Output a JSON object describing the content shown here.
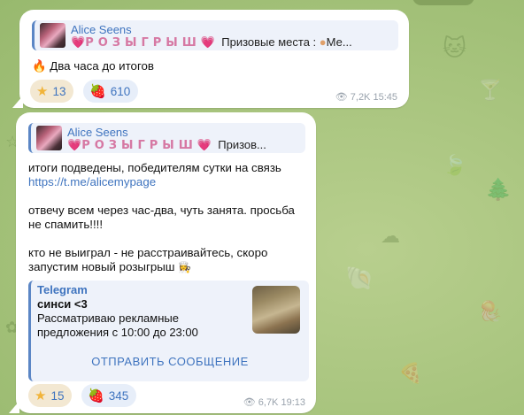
{
  "messages": [
    {
      "reply": {
        "author": "Alice Seens",
        "heart_left": "💗",
        "giveaway_word": "РОЗЫГРЫШ",
        "heart_right": "💗",
        "preview_text": "Призовые места :",
        "preview_tail": "Ме..."
      },
      "text_icon": "fire-icon",
      "text": "Два часа до итогов",
      "reactions": [
        {
          "icon": "star-icon",
          "count": "13"
        },
        {
          "icon": "strawberry-icon",
          "count": "610"
        }
      ],
      "views": "7,2K",
      "time": "15:45"
    },
    {
      "reply": {
        "author": "Alice Seens",
        "heart_left": "💗",
        "giveaway_word": "РОЗЫГРЫШ",
        "heart_right": "💗",
        "preview_text": "Призов..."
      },
      "text_line1": "итоги подведены, победителям сутки на связь",
      "link": "https://t.me/alicemypage",
      "text_para2": "отвечу всем через час-два, чуть занята. просьба\nне спамить!!!!",
      "text_para3": "кто не выиграл - не расстраивайтесь, скоро\nзапустим новый розыгрыш",
      "link_preview": {
        "site": "Telegram",
        "title": "синси <3",
        "description": "Рассматриваю рекламные предложения с 10:00 до 23:00",
        "button": "ОТПРАВИТЬ СООБЩЕНИЕ"
      },
      "reactions": [
        {
          "icon": "star-icon",
          "count": "15"
        },
        {
          "icon": "strawberry-icon",
          "count": "345"
        }
      ],
      "views": "6,7K",
      "time": "19:13"
    }
  ],
  "colors": {
    "accent": "#3f74bf",
    "bubble": "#ffffff",
    "background": "#a9c57f"
  }
}
